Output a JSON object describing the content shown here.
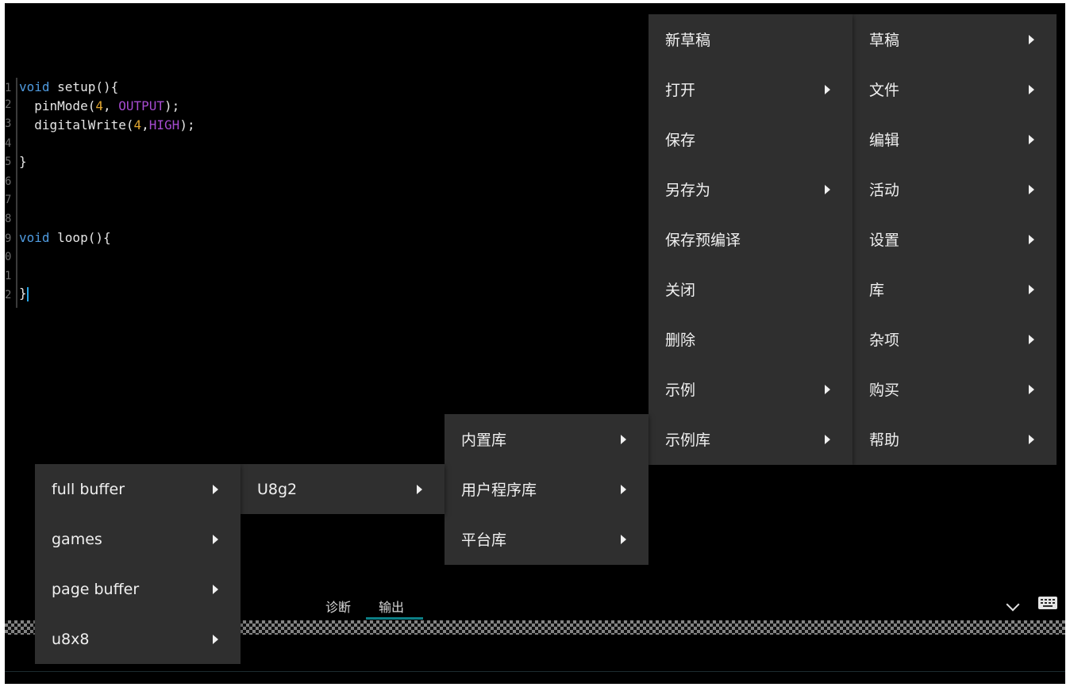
{
  "editor": {
    "line_numbers": [
      "1",
      "2",
      "3",
      "4",
      "5",
      "6",
      "7",
      "8",
      "9",
      "0",
      "1",
      "2"
    ]
  },
  "file_menu": {
    "items": [
      {
        "label": "新草稿",
        "has_submenu": false
      },
      {
        "label": "打开",
        "has_submenu": true
      },
      {
        "label": "保存",
        "has_submenu": false
      },
      {
        "label": "另存为",
        "has_submenu": true
      },
      {
        "label": "保存预编译",
        "has_submenu": false
      },
      {
        "label": "关闭",
        "has_submenu": false
      },
      {
        "label": "删除",
        "has_submenu": false
      },
      {
        "label": "示例",
        "has_submenu": true
      },
      {
        "label": "示例库",
        "has_submenu": true
      }
    ]
  },
  "main_menu": {
    "items": [
      {
        "label": "草稿"
      },
      {
        "label": "文件"
      },
      {
        "label": "编辑"
      },
      {
        "label": "活动"
      },
      {
        "label": "设置"
      },
      {
        "label": "库"
      },
      {
        "label": "杂项"
      },
      {
        "label": "购买"
      },
      {
        "label": "帮助"
      }
    ]
  },
  "library_menu": {
    "items": [
      {
        "label": "内置库"
      },
      {
        "label": "用户程序库"
      },
      {
        "label": "平台库"
      }
    ]
  },
  "u8g2_menu": {
    "items": [
      {
        "label": "U8g2"
      }
    ]
  },
  "examples_menu": {
    "items": [
      {
        "label": "full buffer"
      },
      {
        "label": "games"
      },
      {
        "label": "page buffer"
      },
      {
        "label": "u8x8"
      }
    ]
  },
  "bottom_panel": {
    "tabs": [
      "诊断",
      "输出"
    ],
    "active_tab": "输出",
    "collapse_icon": "chevron-down-icon",
    "keyboard_icon": "keyboard-icon"
  },
  "colors": {
    "keyword": "#4f9be0",
    "number": "#e0a530",
    "constant": "#a64bd0",
    "menu_bg": "#2f2f2f",
    "tab_indicator": "#0d7f86"
  }
}
